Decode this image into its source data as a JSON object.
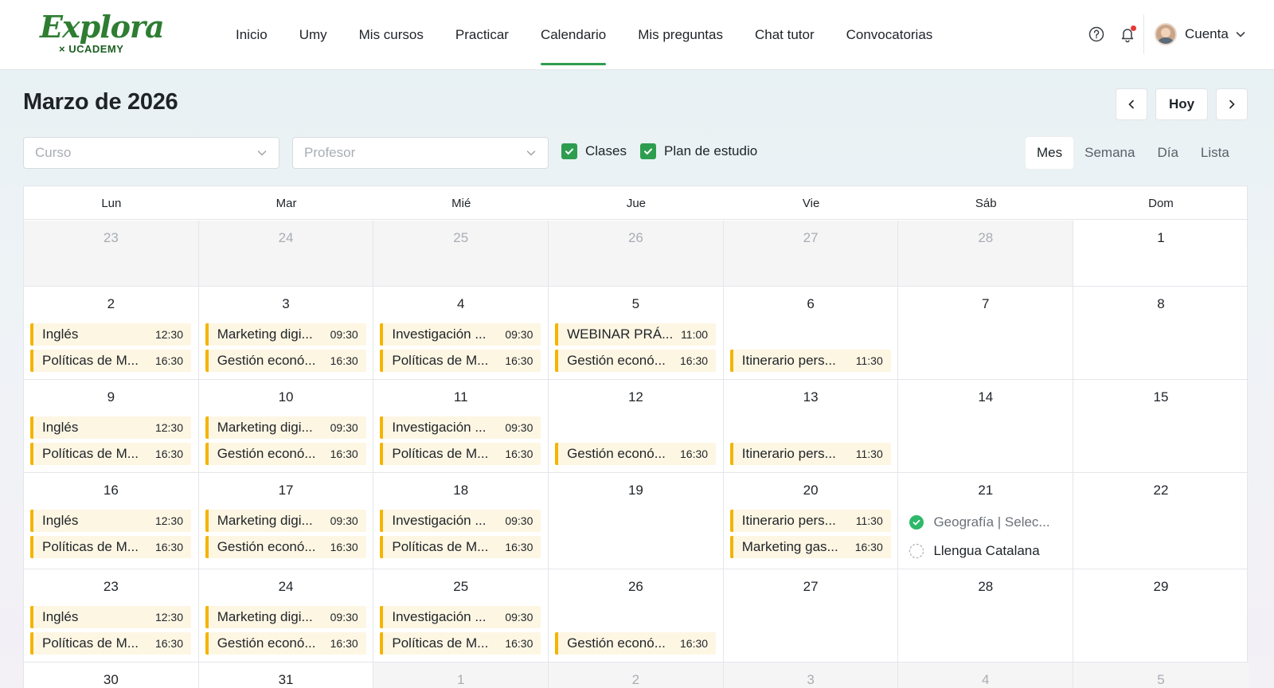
{
  "brand": {
    "name": "Explora",
    "sub": "× UCADEMY",
    "color": "#2e7d32"
  },
  "nav": {
    "items": [
      "Inicio",
      "Umy",
      "Mis cursos",
      "Practicar",
      "Calendario",
      "Mis preguntas",
      "Chat tutor",
      "Convocatorias"
    ],
    "active": "Calendario"
  },
  "header": {
    "help_icon": "help-circle-icon",
    "bell_icon": "bell-icon",
    "account_label": "Cuenta"
  },
  "page": {
    "title": "Marzo de 2026",
    "today_label": "Hoy"
  },
  "filters": {
    "course_placeholder": "Curso",
    "teacher_placeholder": "Profesor",
    "checks": [
      {
        "label": "Clases",
        "checked": true
      },
      {
        "label": "Plan de estudio",
        "checked": true
      }
    ]
  },
  "views": {
    "items": [
      "Mes",
      "Semana",
      "Día",
      "Lista"
    ],
    "active": "Mes"
  },
  "colors": {
    "accent": "#2e9d4f",
    "event_bar": "#f4b400",
    "event_bg": "#fdf6e3",
    "done": "#2eb86a"
  },
  "calendar": {
    "weekdays": [
      "Lun",
      "Mar",
      "Mié",
      "Jue",
      "Vie",
      "Sáb",
      "Dom"
    ],
    "weeks": [
      [
        {
          "n": "23",
          "other": true,
          "events": []
        },
        {
          "n": "24",
          "other": true,
          "events": []
        },
        {
          "n": "25",
          "other": true,
          "events": []
        },
        {
          "n": "26",
          "other": true,
          "events": []
        },
        {
          "n": "27",
          "other": true,
          "events": []
        },
        {
          "n": "28",
          "other": true,
          "events": []
        },
        {
          "n": "1",
          "other": false,
          "events": []
        }
      ],
      [
        {
          "n": "2",
          "events": [
            {
              "t": "Inglés",
              "h": "12:30"
            },
            {
              "t": "Políticas de M...",
              "h": "16:30"
            }
          ]
        },
        {
          "n": "3",
          "events": [
            {
              "t": "Marketing digi...",
              "h": "09:30"
            },
            {
              "t": "Gestión econó...",
              "h": "16:30"
            }
          ]
        },
        {
          "n": "4",
          "events": [
            {
              "t": "Investigación ...",
              "h": "09:30"
            },
            {
              "t": "Políticas de M...",
              "h": "16:30"
            }
          ]
        },
        {
          "n": "5",
          "events": [
            {
              "t": "WEBINAR PRÁ...",
              "h": "11:00"
            },
            {
              "t": "Gestión econó...",
              "h": "16:30"
            }
          ]
        },
        {
          "n": "6",
          "events": [
            {
              "t": "Itinerario pers...",
              "h": "11:30",
              "slot": 1
            }
          ]
        },
        {
          "n": "7",
          "events": []
        },
        {
          "n": "8",
          "events": []
        }
      ],
      [
        {
          "n": "9",
          "events": [
            {
              "t": "Inglés",
              "h": "12:30"
            },
            {
              "t": "Políticas de M...",
              "h": "16:30"
            }
          ]
        },
        {
          "n": "10",
          "events": [
            {
              "t": "Marketing digi...",
              "h": "09:30"
            },
            {
              "t": "Gestión econó...",
              "h": "16:30"
            }
          ]
        },
        {
          "n": "11",
          "events": [
            {
              "t": "Investigación ...",
              "h": "09:30"
            },
            {
              "t": "Políticas de M...",
              "h": "16:30"
            }
          ]
        },
        {
          "n": "12",
          "events": [
            {
              "t": "Gestión econó...",
              "h": "16:30",
              "slot": 1
            }
          ]
        },
        {
          "n": "13",
          "events": [
            {
              "t": "Itinerario pers...",
              "h": "11:30",
              "slot": 1
            }
          ]
        },
        {
          "n": "14",
          "events": []
        },
        {
          "n": "15",
          "events": []
        }
      ],
      [
        {
          "n": "16",
          "events": [
            {
              "t": "Inglés",
              "h": "12:30"
            },
            {
              "t": "Políticas de M...",
              "h": "16:30"
            }
          ]
        },
        {
          "n": "17",
          "events": [
            {
              "t": "Marketing digi...",
              "h": "09:30"
            },
            {
              "t": "Gestión econó...",
              "h": "16:30"
            }
          ]
        },
        {
          "n": "18",
          "events": [
            {
              "t": "Investigación ...",
              "h": "09:30"
            },
            {
              "t": "Políticas de M...",
              "h": "16:30"
            }
          ]
        },
        {
          "n": "19",
          "events": []
        },
        {
          "n": "20",
          "events": [
            {
              "t": "Itinerario pers...",
              "h": "11:30"
            },
            {
              "t": "Marketing gas...",
              "h": "16:30"
            }
          ]
        },
        {
          "n": "21",
          "plans": [
            {
              "t": "Geografía | Selec...",
              "done": true
            },
            {
              "t": "Llengua Catalana",
              "done": false
            }
          ]
        },
        {
          "n": "22",
          "events": []
        }
      ],
      [
        {
          "n": "23",
          "events": [
            {
              "t": "Inglés",
              "h": "12:30"
            },
            {
              "t": "Políticas de M...",
              "h": "16:30"
            }
          ]
        },
        {
          "n": "24",
          "events": [
            {
              "t": "Marketing digi...",
              "h": "09:30"
            },
            {
              "t": "Gestión econó...",
              "h": "16:30"
            }
          ]
        },
        {
          "n": "25",
          "events": [
            {
              "t": "Investigación ...",
              "h": "09:30"
            },
            {
              "t": "Políticas de M...",
              "h": "16:30"
            }
          ]
        },
        {
          "n": "26",
          "events": [
            {
              "t": "Gestión econó...",
              "h": "16:30",
              "slot": 1
            }
          ]
        },
        {
          "n": "27",
          "events": []
        },
        {
          "n": "28",
          "events": []
        },
        {
          "n": "29",
          "events": []
        }
      ],
      [
        {
          "n": "30",
          "events": []
        },
        {
          "n": "31",
          "events": []
        },
        {
          "n": "1",
          "other": true,
          "events": []
        },
        {
          "n": "2",
          "other": true,
          "events": []
        },
        {
          "n": "3",
          "other": true,
          "events": []
        },
        {
          "n": "4",
          "other": true,
          "events": []
        },
        {
          "n": "5",
          "other": true,
          "events": []
        }
      ]
    ]
  }
}
